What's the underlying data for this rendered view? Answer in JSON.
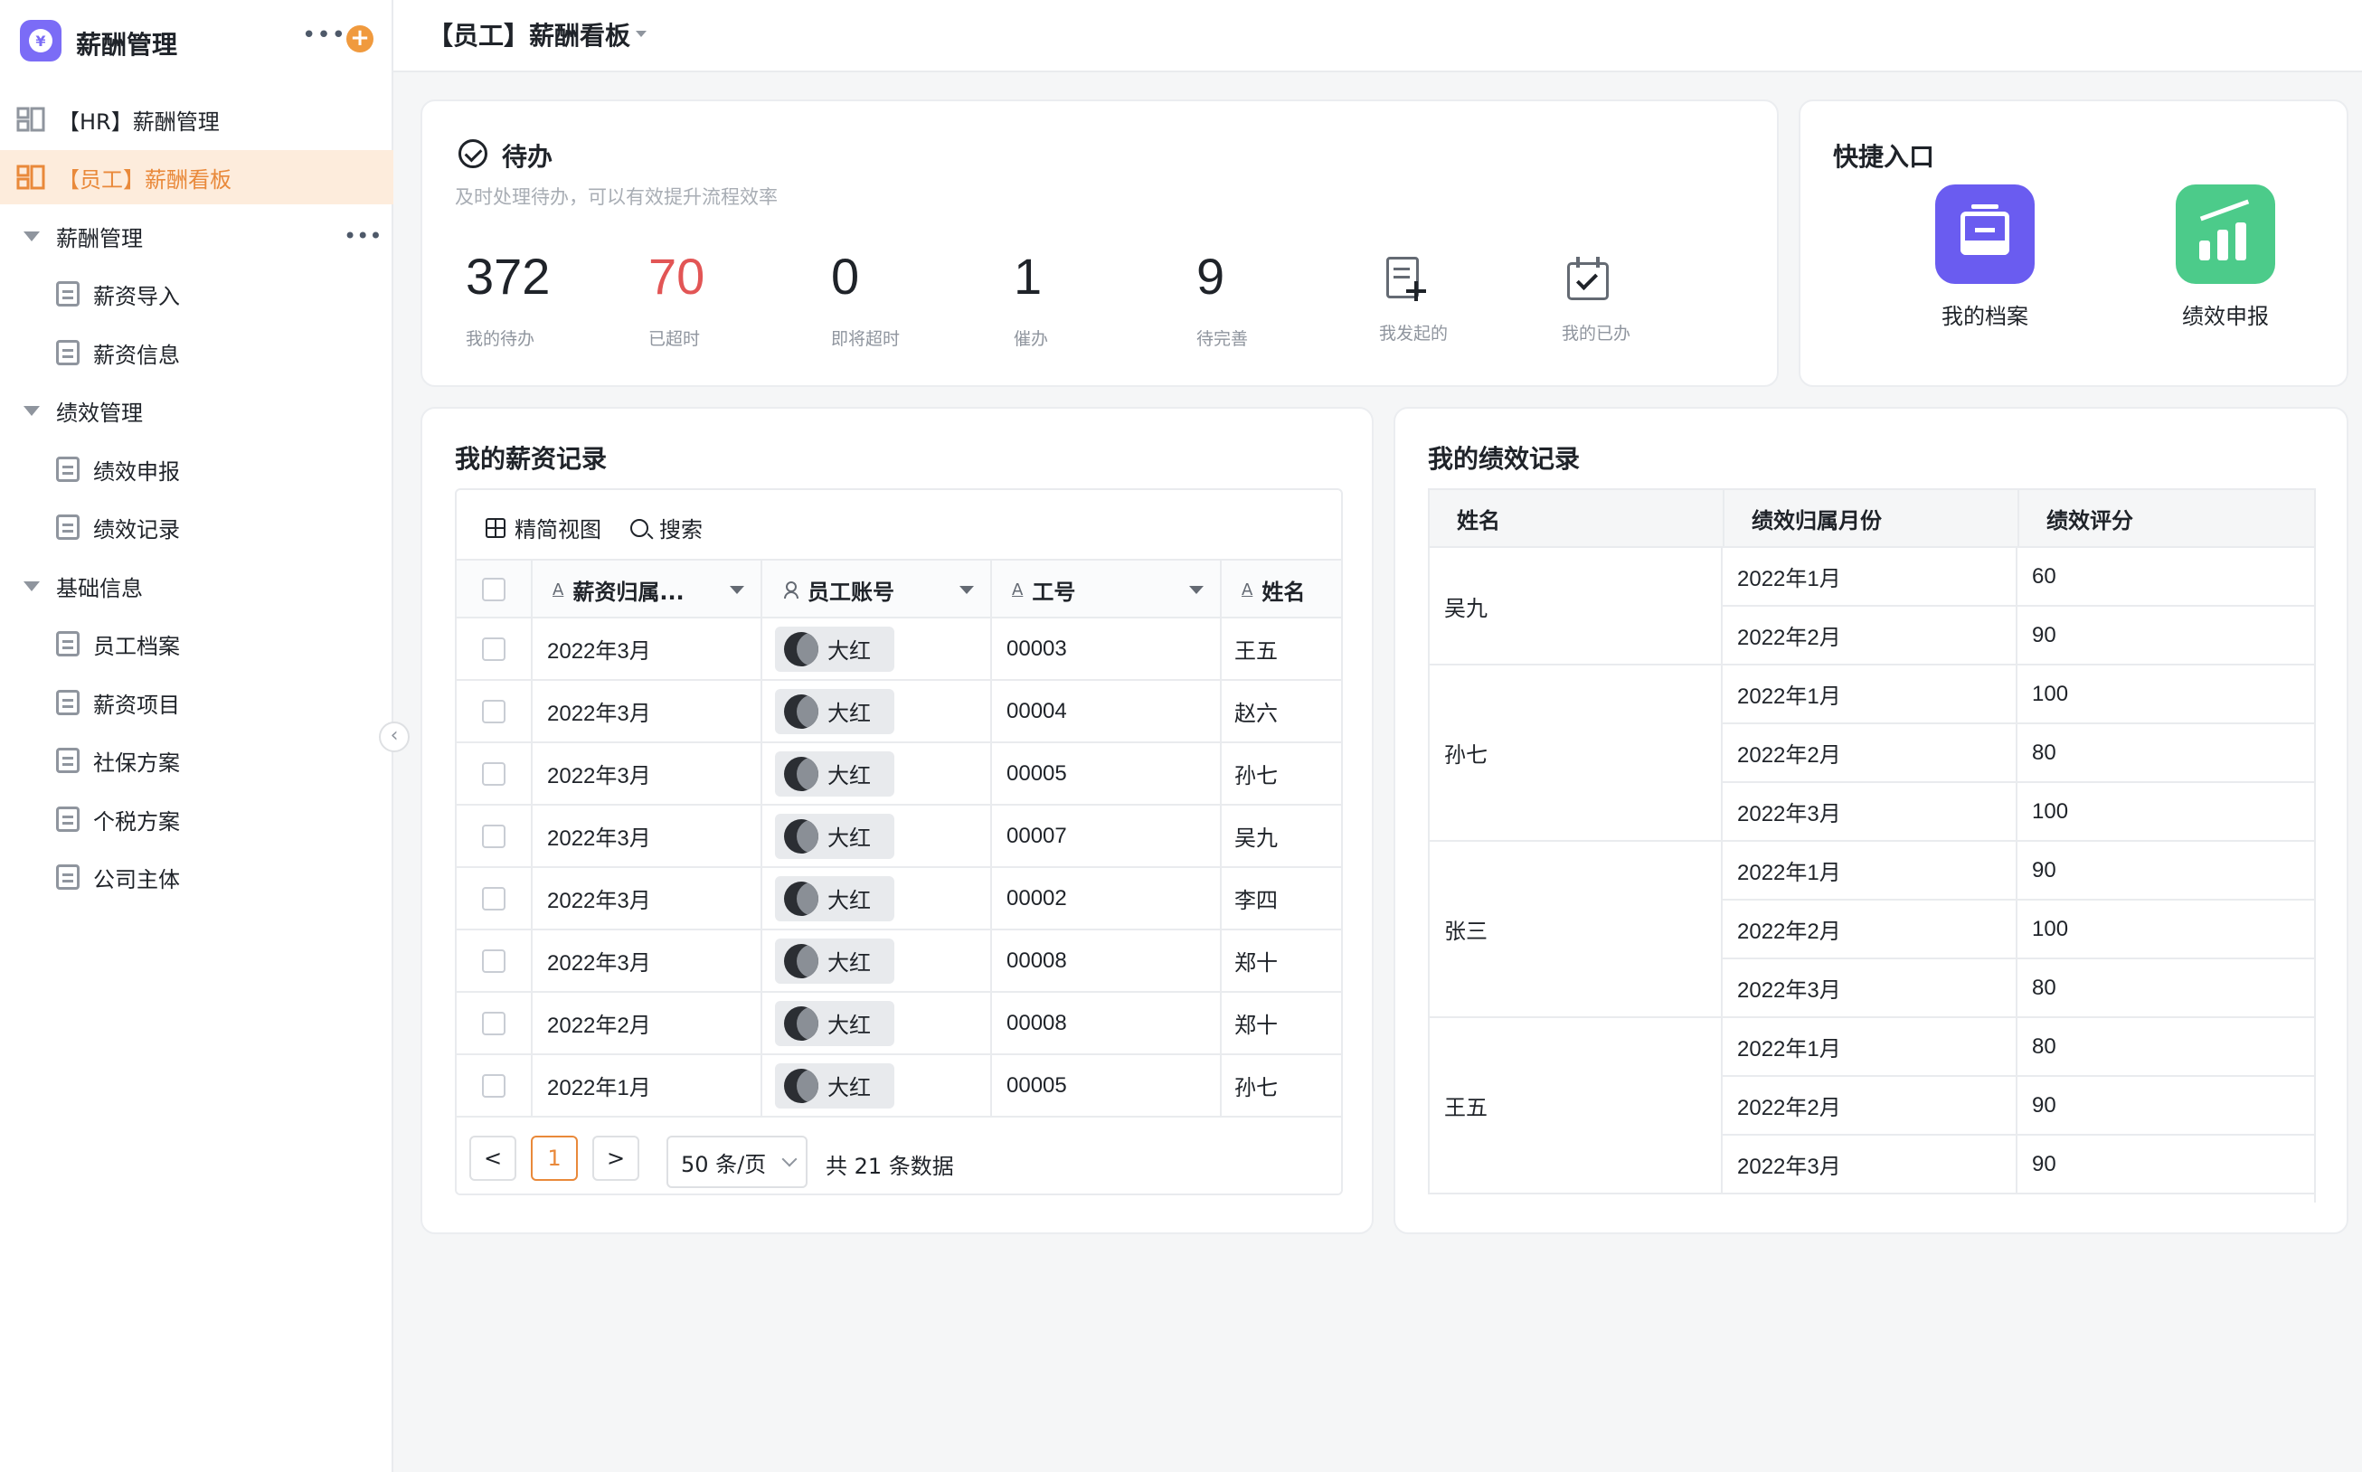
{
  "sidebar": {
    "app_title": "薪酬管理",
    "top_items": [
      {
        "label": "【HR】薪酬管理",
        "active": false
      },
      {
        "label": "【员工】薪酬看板",
        "active": true
      }
    ],
    "groups": [
      {
        "label": "薪酬管理",
        "items": [
          "薪资导入",
          "薪资信息"
        ]
      },
      {
        "label": "绩效管理",
        "items": [
          "绩效申报",
          "绩效记录"
        ]
      },
      {
        "label": "基础信息",
        "items": [
          "员工档案",
          "薪资项目",
          "社保方案",
          "个税方案",
          "公司主体"
        ]
      }
    ]
  },
  "topbar": {
    "title": "【员工】薪酬看板"
  },
  "todo": {
    "title": "待办",
    "subtitle": "及时处理待办，可以有效提升流程效率",
    "stats": [
      {
        "value": "372",
        "label": "我的待办"
      },
      {
        "value": "70",
        "label": "已超时"
      },
      {
        "value": "0",
        "label": "即将超时"
      },
      {
        "value": "1",
        "label": "催办"
      },
      {
        "value": "9",
        "label": "待完善"
      }
    ],
    "actions": [
      {
        "label": "我发起的",
        "icon": "file-plus-icon"
      },
      {
        "label": "我的已办",
        "icon": "calendar-check-icon"
      }
    ]
  },
  "quick": {
    "title": "快捷入口",
    "items": [
      {
        "label": "我的档案",
        "icon": "inbox-icon",
        "color": "#6a5cf0"
      },
      {
        "label": "绩效申报",
        "icon": "bar-chart-icon",
        "color": "#4ccb8a"
      }
    ]
  },
  "salary": {
    "title": "我的薪资记录",
    "tools": {
      "view": "精简视图",
      "search": "搜索"
    },
    "columns": [
      "薪资归属...",
      "员工账号",
      "工号",
      "姓名"
    ],
    "rows": [
      {
        "month": "2022年3月",
        "account": "大红",
        "id": "00003",
        "name": "王五"
      },
      {
        "month": "2022年3月",
        "account": "大红",
        "id": "00004",
        "name": "赵六"
      },
      {
        "month": "2022年3月",
        "account": "大红",
        "id": "00005",
        "name": "孙七"
      },
      {
        "month": "2022年3月",
        "account": "大红",
        "id": "00007",
        "name": "吴九"
      },
      {
        "month": "2022年3月",
        "account": "大红",
        "id": "00002",
        "name": "李四"
      },
      {
        "month": "2022年3月",
        "account": "大红",
        "id": "00008",
        "name": "郑十"
      },
      {
        "month": "2022年2月",
        "account": "大红",
        "id": "00008",
        "name": "郑十"
      },
      {
        "month": "2022年1月",
        "account": "大红",
        "id": "00005",
        "name": "孙七"
      }
    ],
    "pager": {
      "prev": "<",
      "page": "1",
      "next": ">",
      "size": "50 条/页",
      "total": "共 21 条数据"
    }
  },
  "perf": {
    "title": "我的绩效记录",
    "columns": [
      "姓名",
      "绩效归属月份",
      "绩效评分"
    ],
    "groups": [
      {
        "name": "吴九",
        "rows": [
          [
            "2022年1月",
            "60"
          ],
          [
            "2022年2月",
            "90"
          ]
        ]
      },
      {
        "name": "孙七",
        "rows": [
          [
            "2022年1月",
            "100"
          ],
          [
            "2022年2月",
            "80"
          ],
          [
            "2022年3月",
            "100"
          ]
        ]
      },
      {
        "name": "张三",
        "rows": [
          [
            "2022年1月",
            "90"
          ],
          [
            "2022年2月",
            "100"
          ],
          [
            "2022年3月",
            "80"
          ]
        ]
      },
      {
        "name": "王五",
        "rows": [
          [
            "2022年1月",
            "80"
          ],
          [
            "2022年2月",
            "90"
          ],
          [
            "2022年3月",
            "90"
          ]
        ]
      }
    ]
  }
}
